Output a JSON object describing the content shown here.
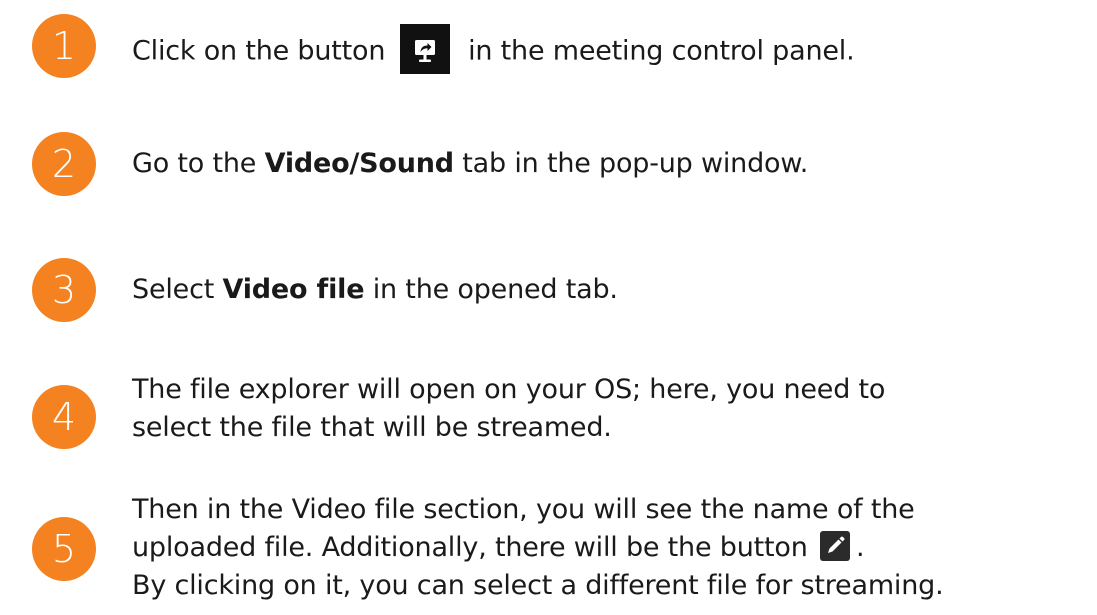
{
  "colors": {
    "accent": "#f58220",
    "text": "#1a1a1a",
    "button_dark": "#111111"
  },
  "steps": [
    {
      "number": "1",
      "text_before": "Click on the button",
      "icon": "share-screen-icon",
      "text_after": "in the meeting control panel."
    },
    {
      "number": "2",
      "text_before": "Go to the ",
      "bold": "Video/Sound",
      "text_after": " tab in the pop-up window."
    },
    {
      "number": "3",
      "text_before": "Select ",
      "bold": "Video file",
      "text_after": " in the opened tab."
    },
    {
      "number": "4",
      "line1": "The file explorer will open on your OS; here, you need to",
      "line2": "select the file that will be streamed."
    },
    {
      "number": "5",
      "line1": "Then in the Video file section, you will see the name of the",
      "line2_before": "uploaded file. Additionally, there will be the button",
      "icon": "pencil-icon",
      "line2_after": ".",
      "line3": "By clicking on it, you can select a different file for streaming."
    }
  ]
}
